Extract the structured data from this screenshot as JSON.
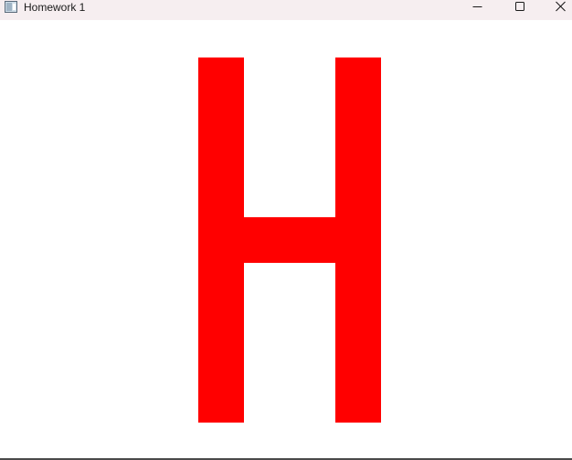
{
  "window": {
    "title": "Homework 1"
  },
  "title_bar_buttons": {
    "minimize_icon": "minimize-icon",
    "maximize_icon": "maximize-icon",
    "close_icon": "close-icon"
  },
  "canvas": {
    "shape": "letter-H",
    "fill_color": "#ff0000",
    "background_color": "#ffffff"
  }
}
